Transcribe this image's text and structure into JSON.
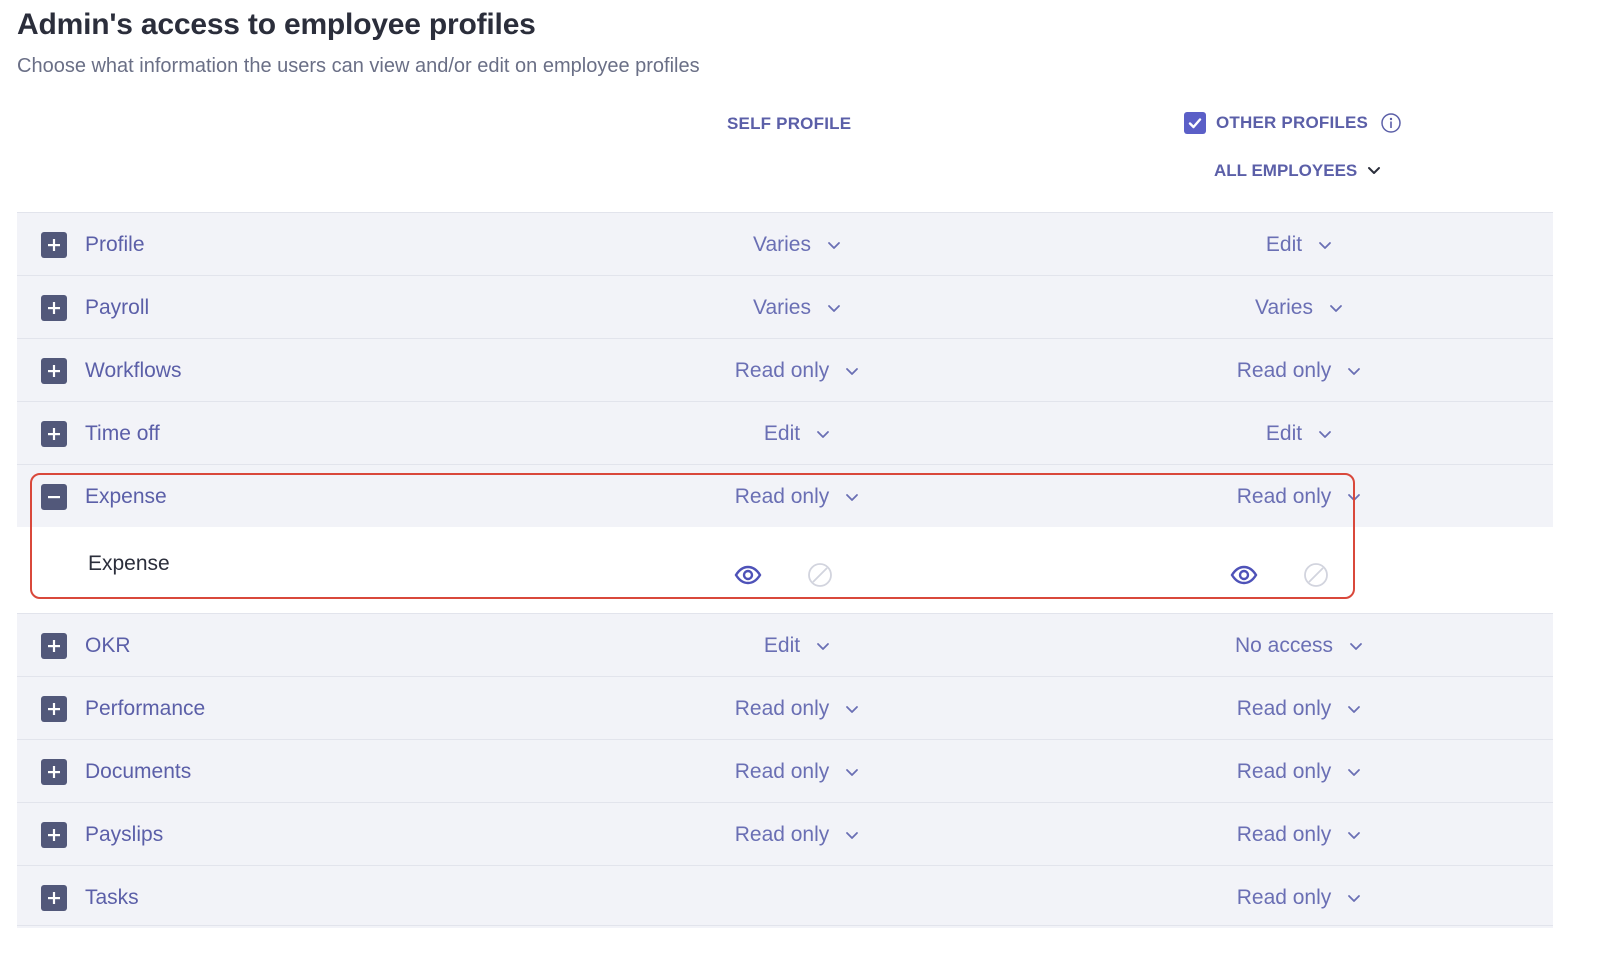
{
  "header": {
    "title": "Admin's access to employee profiles",
    "subtitle": "Choose what information the users can view and/or edit on employee profiles"
  },
  "columns": {
    "self_label": "SELF PROFILE",
    "other_label": "OTHER PROFILES",
    "other_checked": true,
    "scope_label": "ALL EMPLOYEES"
  },
  "rows": [
    {
      "label": "Profile",
      "self": "Varies",
      "other": "Edit"
    },
    {
      "label": "Payroll",
      "self": "Varies",
      "other": "Varies"
    },
    {
      "label": "Workflows",
      "self": "Read only",
      "other": "Read only"
    },
    {
      "label": "Time off",
      "self": "Edit",
      "other": "Edit"
    },
    {
      "label": "Expense",
      "self": "Read only",
      "other": "Read only",
      "expanded": true
    },
    {
      "label": "OKR",
      "self": "Edit",
      "other": "No access"
    },
    {
      "label": "Performance",
      "self": "Read only",
      "other": "Read only"
    },
    {
      "label": "Documents",
      "self": "Read only",
      "other": "Read only"
    },
    {
      "label": "Payslips",
      "self": "Read only",
      "other": "Read only"
    },
    {
      "label": "Tasks",
      "self": "",
      "other": "Read only"
    }
  ],
  "expense_detail": {
    "label": "Expense",
    "self_view_icon": "eye-icon",
    "self_none_icon": "no-access-icon",
    "other_view_icon": "eye-icon",
    "other_none_icon": "no-access-icon"
  },
  "colors": {
    "accent": "#5b5fc7",
    "row_bg": "#f2f3f8",
    "highlight": "#d9483b"
  }
}
